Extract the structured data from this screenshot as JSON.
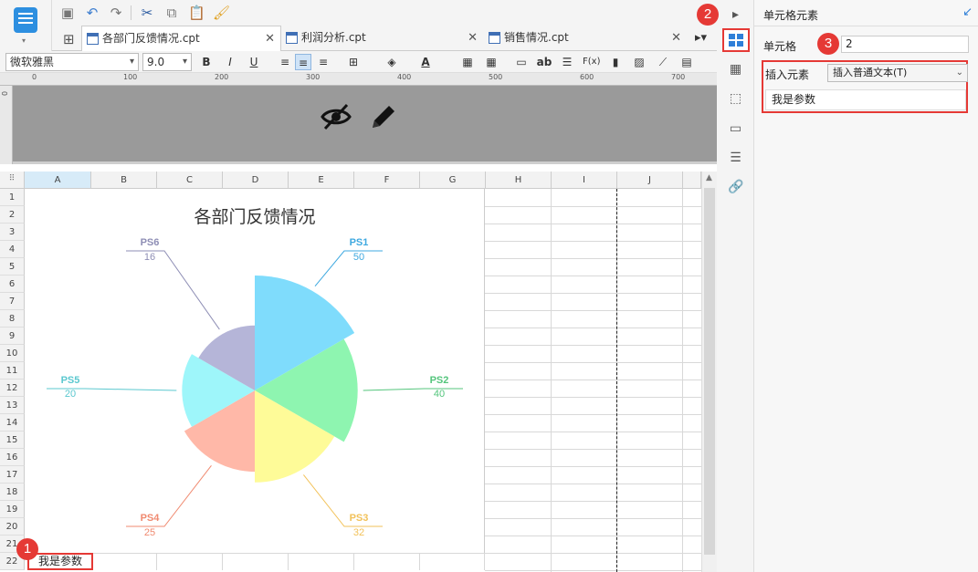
{
  "tabs": [
    {
      "label": "各部门反馈情况.cpt",
      "active": true
    },
    {
      "label": "利润分析.cpt",
      "active": false
    },
    {
      "label": "销售情况.cpt",
      "active": false
    }
  ],
  "toolbar": {
    "font_family": "微软雅黑",
    "font_size": "9.0",
    "icons": [
      "save-icon",
      "undo-icon",
      "redo-icon",
      "cut-icon",
      "copy-icon",
      "paste-icon",
      "format-brush-icon"
    ]
  },
  "ruler": {
    "ticks": [
      "0",
      "100",
      "200",
      "300",
      "400",
      "500",
      "600",
      "700"
    ],
    "v_zero": "0"
  },
  "grid": {
    "columns": [
      "A",
      "B",
      "C",
      "D",
      "E",
      "F",
      "G",
      "H",
      "I",
      "J"
    ],
    "rows": [
      "1",
      "2",
      "3",
      "4",
      "5",
      "6",
      "7",
      "8",
      "9",
      "10",
      "11",
      "12",
      "13",
      "14",
      "15",
      "16",
      "17",
      "18",
      "19",
      "20",
      "21",
      "22"
    ],
    "selected_column": "A",
    "selected_cell_value": "我是参数"
  },
  "chart_data": {
    "type": "pie",
    "variant": "rose",
    "title": "各部门反馈情况",
    "categories": [
      "PS1",
      "PS2",
      "PS3",
      "PS4",
      "PS5",
      "PS6"
    ],
    "values": [
      50,
      40,
      32,
      25,
      20,
      16
    ],
    "colors": [
      "#7fdcfc",
      "#8ef5b0",
      "#fefb98",
      "#ffb8a8",
      "#9ef6fa",
      "#b5b5d8"
    ],
    "label_colors": [
      "#3fa9e0",
      "#54c57c",
      "#f2c25a",
      "#f08a70",
      "#5bc8cf",
      "#8e8eb5"
    ]
  },
  "panel": {
    "title": "单元格元素",
    "cell_label": "单元格",
    "cell_value": "2",
    "insert_label": "插入元素",
    "insert_option": "插入普通文本(T)",
    "text_value": "我是参数"
  },
  "callouts": [
    "1",
    "2",
    "3"
  ],
  "colors": {
    "accent": "#2f7fd8",
    "highlight": "#e53935",
    "selected_header": "#d7ebf8"
  }
}
